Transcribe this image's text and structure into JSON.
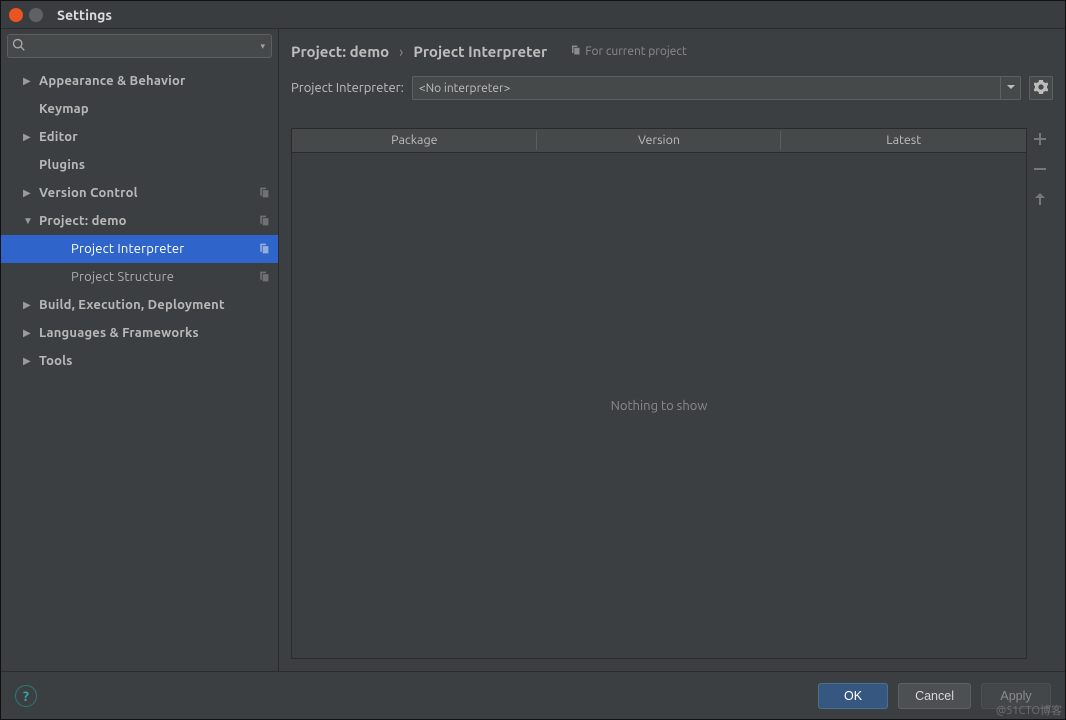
{
  "window": {
    "title": "Settings"
  },
  "sidebar": {
    "search_placeholder": "",
    "items": [
      {
        "label": "Appearance & Behavior",
        "expandable": true,
        "expanded": false,
        "depth": 0
      },
      {
        "label": "Keymap",
        "expandable": false,
        "depth": 0
      },
      {
        "label": "Editor",
        "expandable": true,
        "expanded": false,
        "depth": 0
      },
      {
        "label": "Plugins",
        "expandable": false,
        "depth": 0
      },
      {
        "label": "Version Control",
        "expandable": true,
        "expanded": false,
        "depth": 0,
        "copy": true
      },
      {
        "label": "Project: demo",
        "expandable": true,
        "expanded": true,
        "depth": 0,
        "copy": true
      },
      {
        "label": "Project Interpreter",
        "expandable": false,
        "depth": 1,
        "selected": true,
        "copy": true,
        "child": true
      },
      {
        "label": "Project Structure",
        "expandable": false,
        "depth": 1,
        "copy": true,
        "child": true
      },
      {
        "label": "Build, Execution, Deployment",
        "expandable": true,
        "expanded": false,
        "depth": 0
      },
      {
        "label": "Languages & Frameworks",
        "expandable": true,
        "expanded": false,
        "depth": 0
      },
      {
        "label": "Tools",
        "expandable": true,
        "expanded": false,
        "depth": 0
      }
    ]
  },
  "breadcrumb": {
    "part1": "Project: demo",
    "sep": "›",
    "part2": "Project Interpreter",
    "hint": "For current project"
  },
  "interpreter": {
    "label": "Project Interpreter:",
    "value": "<No interpreter>"
  },
  "table": {
    "columns": [
      "Package",
      "Version",
      "Latest"
    ],
    "empty": "Nothing to show"
  },
  "footer": {
    "ok": "OK",
    "cancel": "Cancel",
    "apply": "Apply"
  },
  "watermark": "@51CTO博客"
}
